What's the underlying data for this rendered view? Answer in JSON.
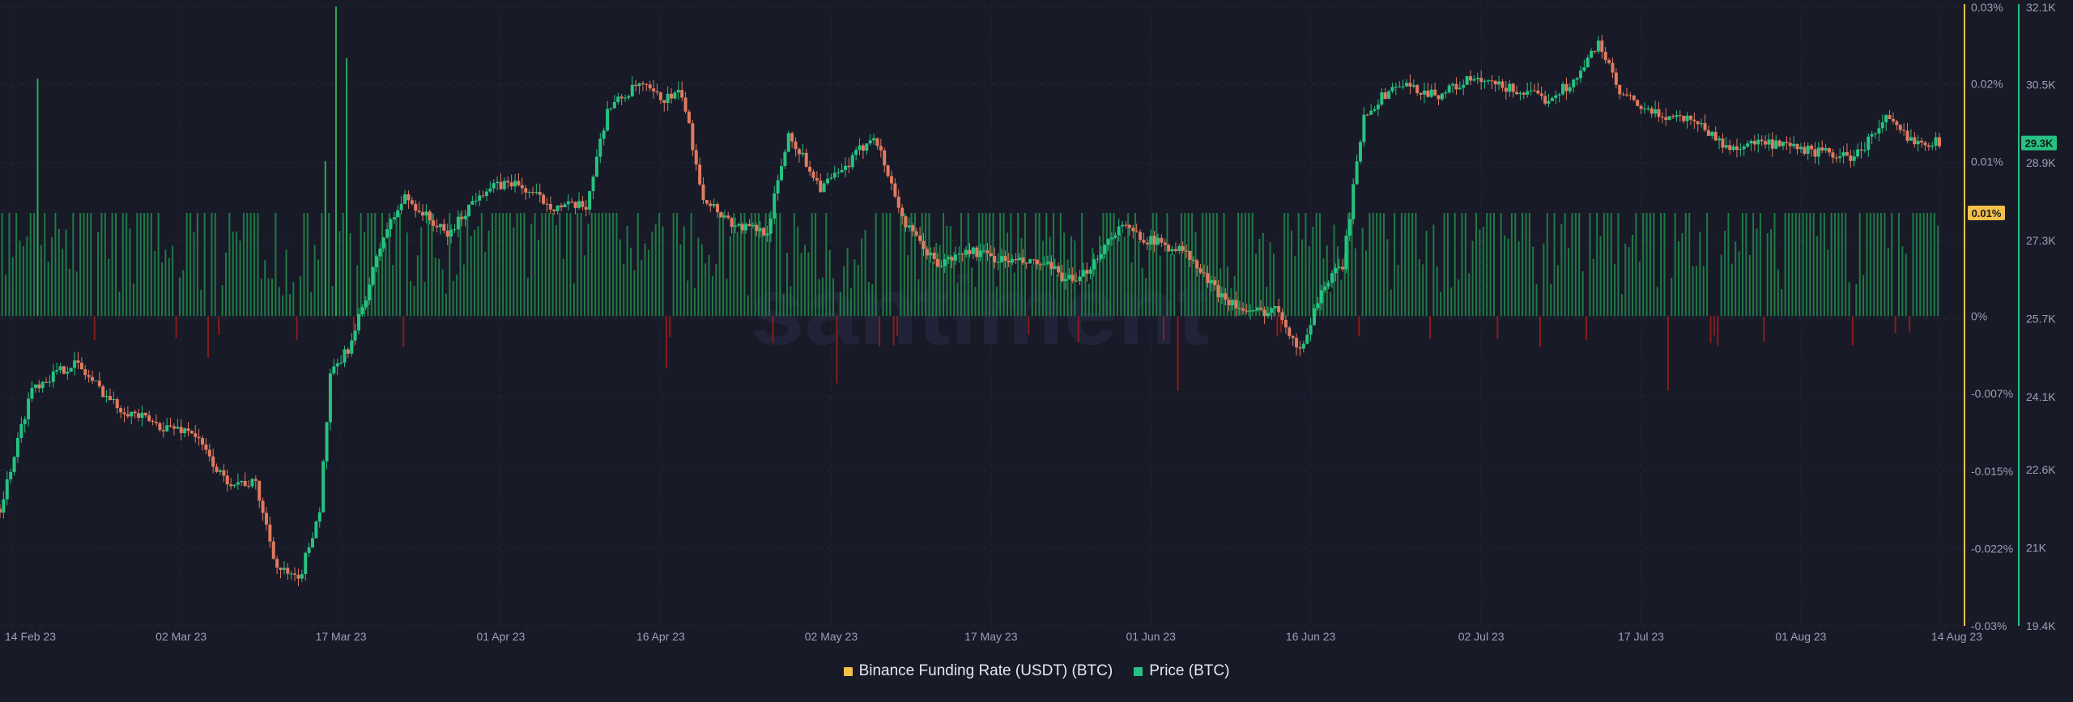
{
  "watermark": "santiment",
  "legend": [
    {
      "name": "Binance Funding Rate (USDT) (BTC)",
      "color": "#f5c04a"
    },
    {
      "name": "Price (BTC)",
      "color": "#26c281"
    }
  ],
  "chart_data": {
    "type": "candlestick+bar",
    "x_range": [
      "2023-02-13",
      "2023-08-14"
    ],
    "x_tick_labels": [
      {
        "date": "2023-02-14",
        "label": "14 Feb 23"
      },
      {
        "date": "2023-03-02",
        "label": "02 Mar 23"
      },
      {
        "date": "2023-03-17",
        "label": "17 Mar 23"
      },
      {
        "date": "2023-04-01",
        "label": "01 Apr 23"
      },
      {
        "date": "2023-04-16",
        "label": "16 Apr 23"
      },
      {
        "date": "2023-05-02",
        "label": "02 May 23"
      },
      {
        "date": "2023-05-17",
        "label": "17 May 23"
      },
      {
        "date": "2023-06-01",
        "label": "01 Jun 23"
      },
      {
        "date": "2023-06-16",
        "label": "16 Jun 23"
      },
      {
        "date": "2023-07-02",
        "label": "02 Jul 23"
      },
      {
        "date": "2023-07-17",
        "label": "17 Jul 23"
      },
      {
        "date": "2023-08-01",
        "label": "01 Aug 23"
      },
      {
        "date": "2023-08-14",
        "label": "14 Aug 23"
      }
    ],
    "funding_axis": {
      "ylim": [
        -0.03,
        0.03
      ],
      "unit": "%",
      "tick_labels": [
        {
          "value": 0.03,
          "label": "0.03%"
        },
        {
          "value": 0.0225,
          "label": "0.02%"
        },
        {
          "value": 0.015,
          "label": "0.01%"
        },
        {
          "value": 0.0,
          "label": "0%"
        },
        {
          "value": -0.0075,
          "label": "-0.007%"
        },
        {
          "value": -0.015,
          "label": "-0.015%"
        },
        {
          "value": -0.0225,
          "label": "-0.022%"
        },
        {
          "value": -0.03,
          "label": "-0.03%"
        }
      ],
      "last_value_label": "0.01%",
      "last_value": 0.01
    },
    "price_axis": {
      "ylim": [
        19400,
        32100
      ],
      "tick_labels": [
        {
          "value": 32100,
          "label": "32.1K"
        },
        {
          "value": 30500,
          "label": "30.5K"
        },
        {
          "value": 28900,
          "label": "28.9K"
        },
        {
          "value": 27300,
          "label": "27.3K"
        },
        {
          "value": 25700,
          "label": "25.7K"
        },
        {
          "value": 24100,
          "label": "24.1K"
        },
        {
          "value": 22600,
          "label": "22.6K"
        },
        {
          "value": 21000,
          "label": "21K"
        },
        {
          "value": 19400,
          "label": "19.4K"
        }
      ],
      "last_value_label": "29.3K",
      "last_value": 29300
    },
    "price_series": {
      "name": "Price (BTC)",
      "color_up": "#26c281",
      "color_down": "#e07a5f",
      "daily_close": [
        {
          "date": "2023-02-13",
          "close": 21800
        },
        {
          "date": "2023-02-16",
          "close": 24300
        },
        {
          "date": "2023-02-20",
          "close": 24800
        },
        {
          "date": "2023-02-24",
          "close": 23900
        },
        {
          "date": "2023-02-28",
          "close": 23500
        },
        {
          "date": "2023-03-03",
          "close": 23400
        },
        {
          "date": "2023-03-06",
          "close": 22400
        },
        {
          "date": "2023-03-09",
          "close": 22300
        },
        {
          "date": "2023-03-11",
          "close": 20600
        },
        {
          "date": "2023-03-13",
          "close": 20300
        },
        {
          "date": "2023-03-15",
          "close": 21800
        },
        {
          "date": "2023-03-16",
          "close": 24500
        },
        {
          "date": "2023-03-18",
          "close": 25200
        },
        {
          "date": "2023-03-21",
          "close": 27400
        },
        {
          "date": "2023-03-23",
          "close": 28200
        },
        {
          "date": "2023-03-27",
          "close": 27400
        },
        {
          "date": "2023-03-30",
          "close": 28300
        },
        {
          "date": "2023-04-02",
          "close": 28500
        },
        {
          "date": "2023-04-06",
          "close": 28000
        },
        {
          "date": "2023-04-09",
          "close": 28000
        },
        {
          "date": "2023-04-11",
          "close": 30000
        },
        {
          "date": "2023-04-14",
          "close": 30500
        },
        {
          "date": "2023-04-16",
          "close": 30200
        },
        {
          "date": "2023-04-18",
          "close": 30300
        },
        {
          "date": "2023-04-20",
          "close": 28200
        },
        {
          "date": "2023-04-23",
          "close": 27600
        },
        {
          "date": "2023-04-26",
          "close": 27500
        },
        {
          "date": "2023-04-28",
          "close": 29500
        },
        {
          "date": "2023-05-01",
          "close": 28400
        },
        {
          "date": "2023-05-03",
          "close": 28700
        },
        {
          "date": "2023-05-06",
          "close": 29500
        },
        {
          "date": "2023-05-09",
          "close": 27600
        },
        {
          "date": "2023-05-12",
          "close": 26800
        },
        {
          "date": "2023-05-15",
          "close": 27100
        },
        {
          "date": "2023-05-18",
          "close": 26900
        },
        {
          "date": "2023-05-22",
          "close": 26800
        },
        {
          "date": "2023-05-25",
          "close": 26400
        },
        {
          "date": "2023-05-29",
          "close": 27600
        },
        {
          "date": "2023-06-01",
          "close": 27300
        },
        {
          "date": "2023-06-04",
          "close": 27100
        },
        {
          "date": "2023-06-07",
          "close": 26300
        },
        {
          "date": "2023-06-10",
          "close": 25800
        },
        {
          "date": "2023-06-13",
          "close": 25900
        },
        {
          "date": "2023-06-15",
          "close": 25000
        },
        {
          "date": "2023-06-17",
          "close": 26300
        },
        {
          "date": "2023-06-19",
          "close": 26800
        },
        {
          "date": "2023-06-21",
          "close": 29900
        },
        {
          "date": "2023-06-24",
          "close": 30500
        },
        {
          "date": "2023-06-28",
          "close": 30300
        },
        {
          "date": "2023-07-01",
          "close": 30600
        },
        {
          "date": "2023-07-05",
          "close": 30400
        },
        {
          "date": "2023-07-08",
          "close": 30200
        },
        {
          "date": "2023-07-11",
          "close": 30600
        },
        {
          "date": "2023-07-13",
          "close": 31400
        },
        {
          "date": "2023-07-15",
          "close": 30300
        },
        {
          "date": "2023-07-18",
          "close": 29900
        },
        {
          "date": "2023-07-22",
          "close": 29800
        },
        {
          "date": "2023-07-25",
          "close": 29200
        },
        {
          "date": "2023-07-28",
          "close": 29300
        },
        {
          "date": "2023-07-31",
          "close": 29200
        },
        {
          "date": "2023-08-03",
          "close": 29100
        },
        {
          "date": "2023-08-06",
          "close": 29000
        },
        {
          "date": "2023-08-09",
          "close": 29800
        },
        {
          "date": "2023-08-11",
          "close": 29400
        },
        {
          "date": "2023-08-14",
          "close": 29300
        }
      ]
    },
    "funding_series": {
      "name": "Binance Funding Rate (USDT) (BTC)",
      "color_positive": "#1e7a45",
      "color_positive_bright": "#2ea85a",
      "color_negative": "#8a1c1c",
      "typical_positive": 0.01,
      "notable_values": [
        {
          "date": "2023-02-16",
          "value": 0.023
        },
        {
          "date": "2023-03-16",
          "value": 0.03
        },
        {
          "date": "2023-03-17",
          "value": 0.025
        },
        {
          "date": "2023-03-15",
          "value": 0.015
        },
        {
          "date": "2023-03-04",
          "value": -0.004
        },
        {
          "date": "2023-04-16",
          "value": -0.005
        },
        {
          "date": "2023-05-02",
          "value": -0.0065
        },
        {
          "date": "2023-06-03",
          "value": -0.0072
        },
        {
          "date": "2023-07-19",
          "value": -0.0072
        }
      ]
    }
  }
}
